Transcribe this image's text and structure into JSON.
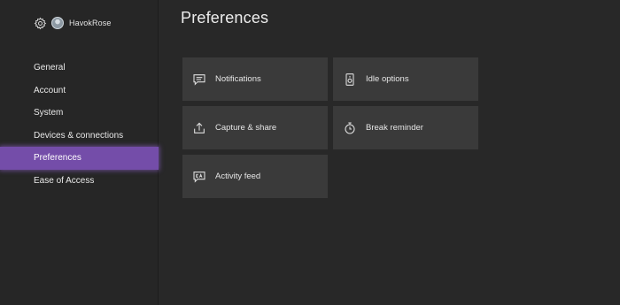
{
  "profile": {
    "gamertag": "HavokRose",
    "settings_icon": "gear-icon",
    "avatar_icon": "avatar"
  },
  "sidebar": {
    "items": [
      {
        "label": "General",
        "selected": false
      },
      {
        "label": "Account",
        "selected": false
      },
      {
        "label": "System",
        "selected": false
      },
      {
        "label": "Devices & connections",
        "selected": false
      },
      {
        "label": "Preferences",
        "selected": true
      },
      {
        "label": "Ease of Access",
        "selected": false
      }
    ]
  },
  "main": {
    "title": "Preferences",
    "tiles": [
      {
        "label": "Notifications",
        "icon": "notification-icon"
      },
      {
        "label": "Idle options",
        "icon": "idle-options-icon"
      },
      {
        "label": "Capture & share",
        "icon": "share-icon"
      },
      {
        "label": "Break reminder",
        "icon": "stopwatch-icon"
      },
      {
        "label": "Activity feed",
        "icon": "activity-feed-icon"
      }
    ]
  },
  "colors": {
    "background": "#282828",
    "sidebar": "#262626",
    "tile": "#3a3a3a",
    "accent": "#744da9",
    "text": "#e6e6e6"
  }
}
